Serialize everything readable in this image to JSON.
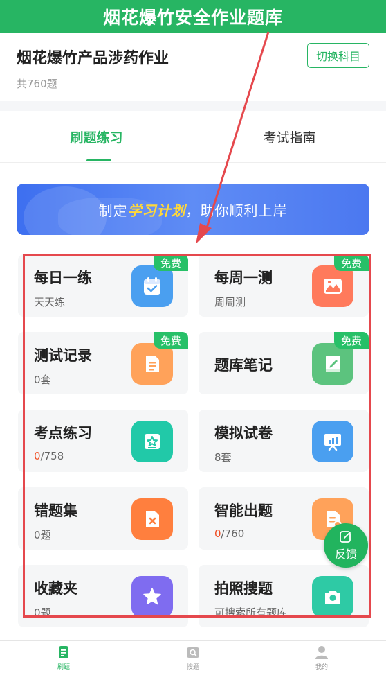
{
  "top_banner": {
    "title": "烟花爆竹安全作业题库"
  },
  "header": {
    "subject_title": "烟花爆竹产品涉药作业",
    "question_count": "共760题",
    "switch_label": "切换科目"
  },
  "tabs": [
    {
      "label": "刷题练习",
      "active": true
    },
    {
      "label": "考试指南",
      "active": false
    }
  ],
  "plan_banner": {
    "prefix": "制定",
    "highlight": "学习计划",
    "suffix": "，助你顺利上岸"
  },
  "free_tag": "免费",
  "cards": [
    {
      "title": "每日一练",
      "subtitle": "天天练",
      "icon": "calendar-check-icon",
      "color": "#4a9ff0",
      "free": true
    },
    {
      "title": "每周一测",
      "subtitle": "周周测",
      "icon": "landscape-chart-icon",
      "color": "#ff7a5c",
      "free": true
    },
    {
      "title": "测试记录",
      "subtitle": "0套",
      "icon": "document-icon",
      "color": "#ffa25a",
      "free": true
    },
    {
      "title": "题库笔记",
      "subtitle": "",
      "icon": "notebook-pen-icon",
      "color": "#5cc37e",
      "free": true
    },
    {
      "title": "考点练习",
      "progress_done": "0",
      "progress_total": "/758",
      "icon": "star-card-icon",
      "color": "#21c9a8",
      "free": false
    },
    {
      "title": "模拟试卷",
      "subtitle": "8套",
      "icon": "presentation-board-icon",
      "color": "#4a9ff0",
      "free": false
    },
    {
      "title": "错题集",
      "subtitle": "0题",
      "icon": "error-document-icon",
      "color": "#ff7f3e",
      "free": false
    },
    {
      "title": "智能出题",
      "progress_done": "0",
      "progress_total": "/760",
      "icon": "smart-document-icon",
      "color": "#ffa25a",
      "free": false
    },
    {
      "title": "收藏夹",
      "subtitle": "0题",
      "icon": "star-icon",
      "color": "#7f6cf0",
      "free": false
    },
    {
      "title": "拍照搜题",
      "subtitle": "可搜索所有题库",
      "icon": "camera-icon",
      "color": "#2ecaa5",
      "free": false
    }
  ],
  "feedback": {
    "label": "反馈"
  },
  "bottom_nav": [
    {
      "label": "刷题",
      "icon": "practice-doc-icon",
      "active": true
    },
    {
      "label": "搜题",
      "icon": "search-photo-icon",
      "active": false
    },
    {
      "label": "我的",
      "icon": "user-icon",
      "active": false
    }
  ],
  "colors": {
    "brand": "#27b563",
    "highlight_border": "#e5484d",
    "progress_done": "#f04e23"
  }
}
